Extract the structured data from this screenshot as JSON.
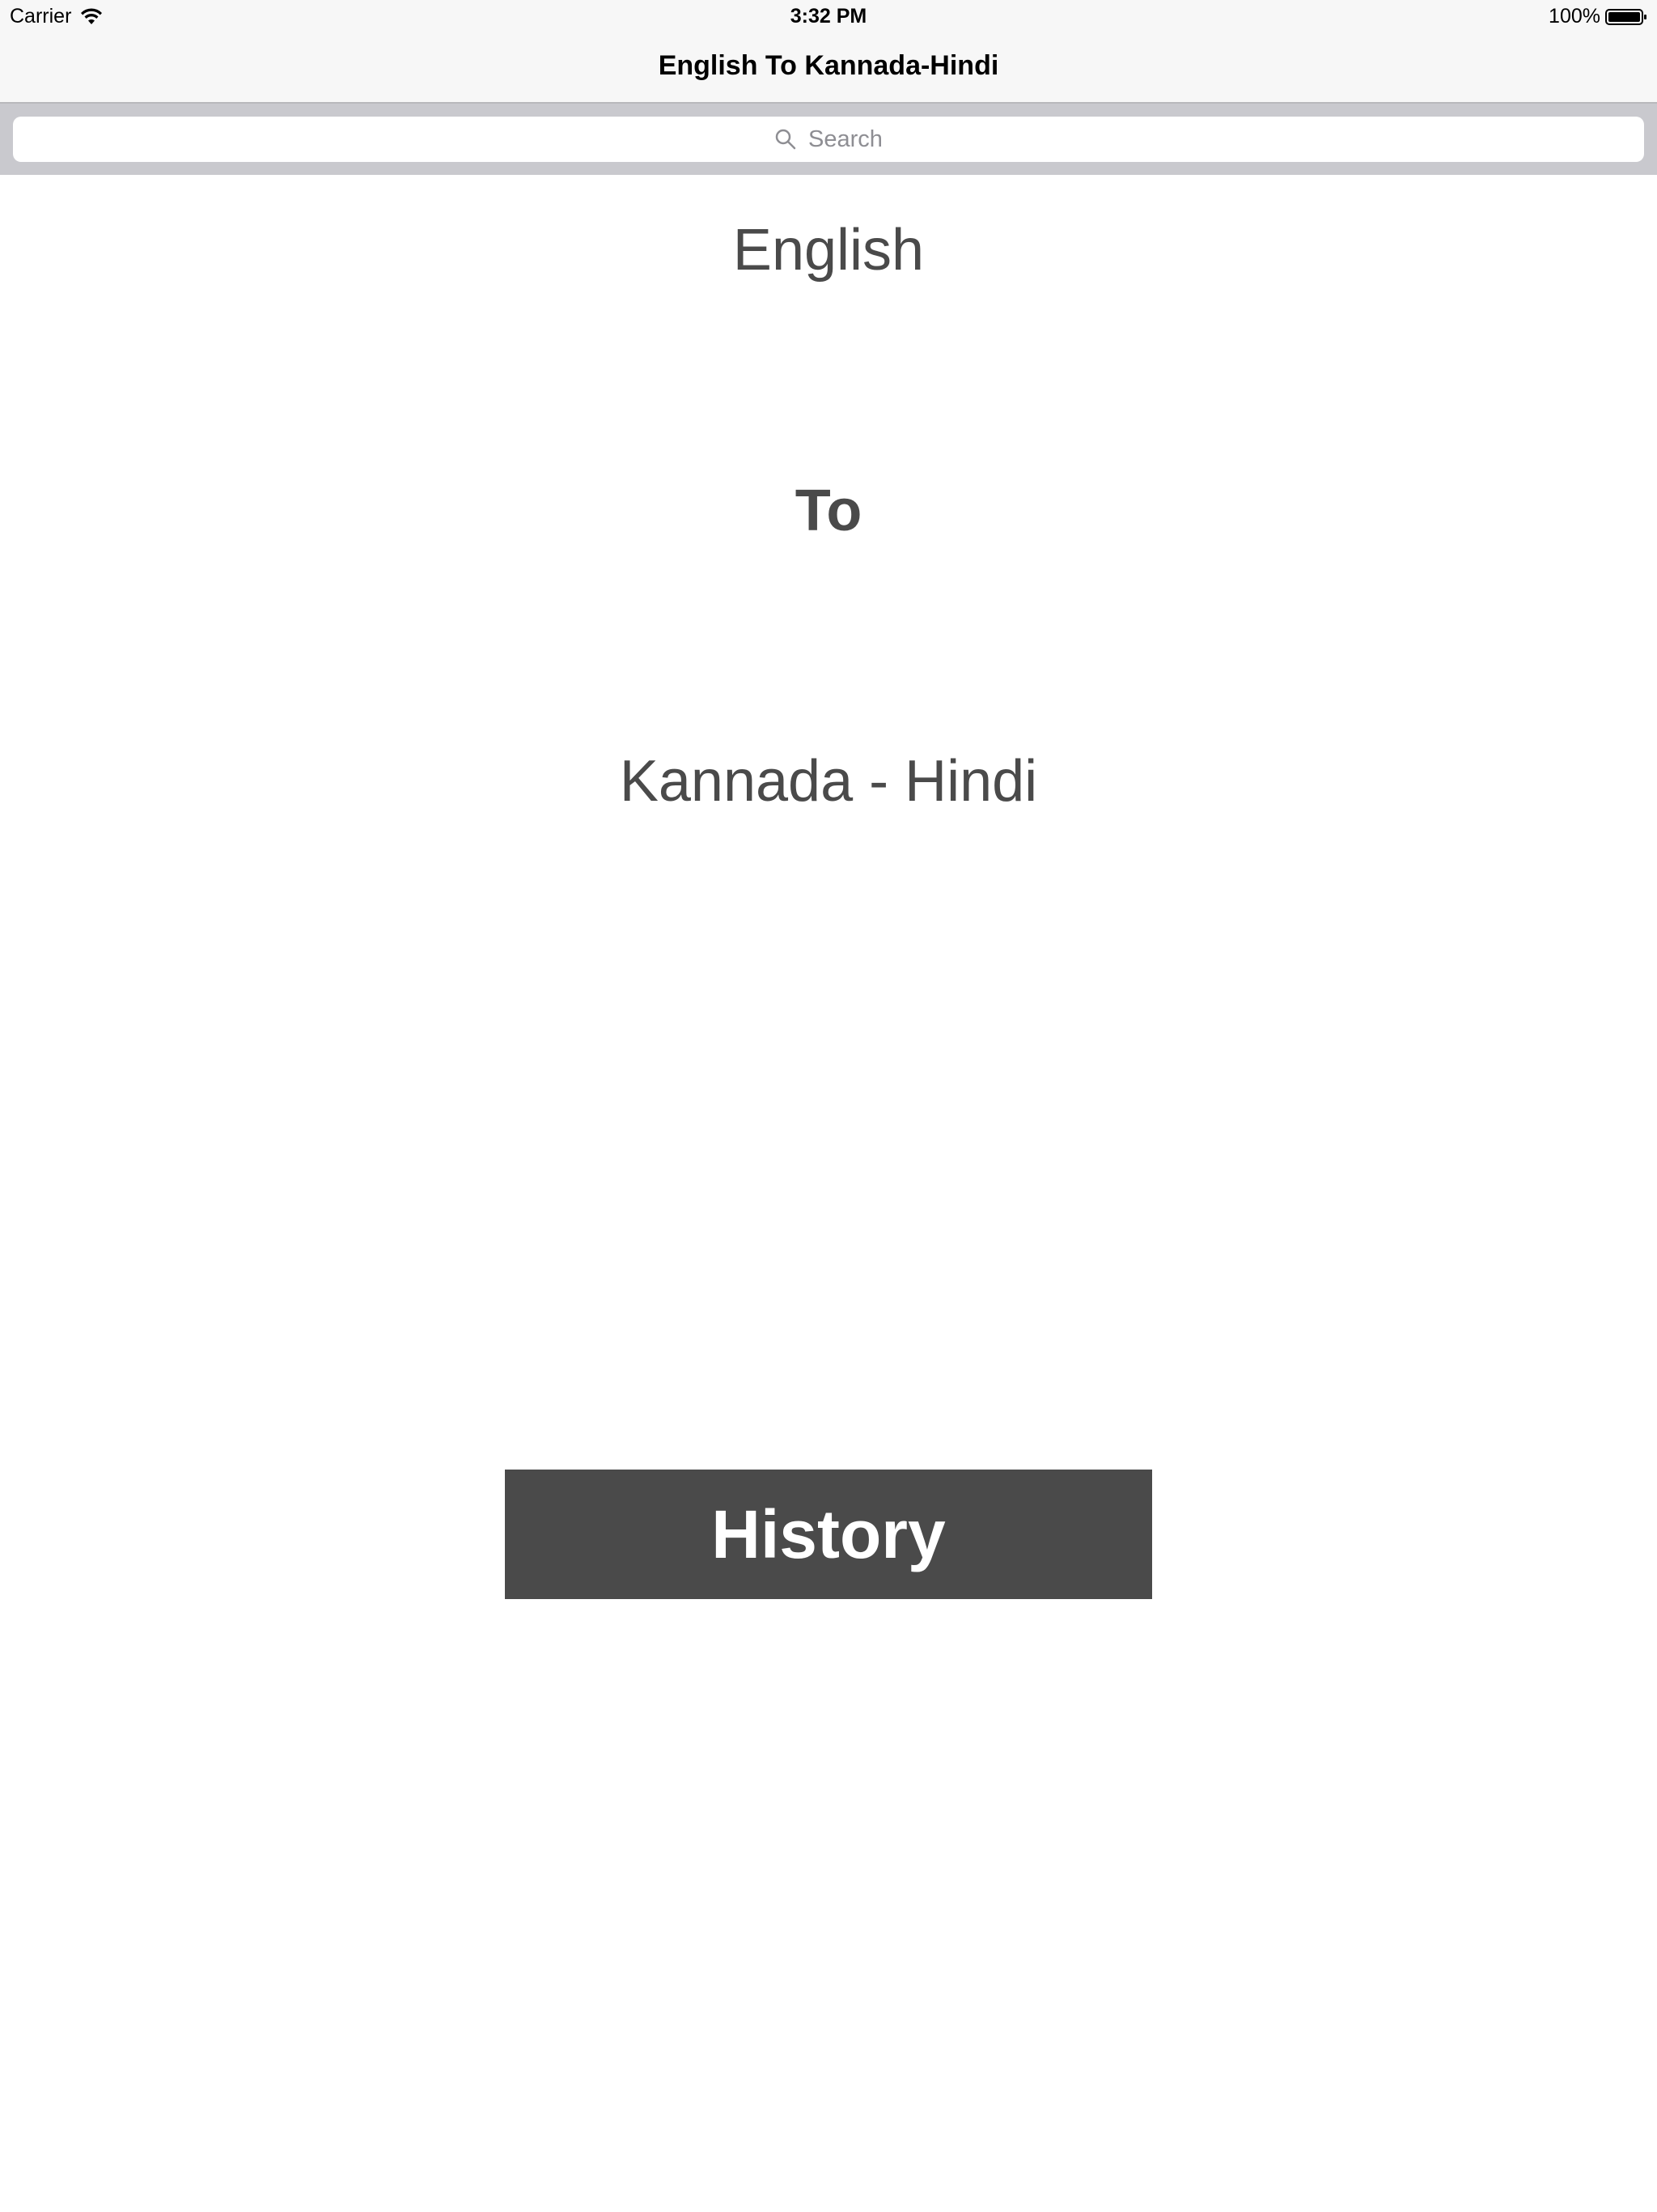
{
  "status_bar": {
    "carrier": "Carrier",
    "time": "3:32 PM",
    "battery": "100%"
  },
  "nav": {
    "title": "English To Kannada-Hindi"
  },
  "search": {
    "placeholder": "Search"
  },
  "main": {
    "line1": "English",
    "line2": "To",
    "line3": "Kannada - Hindi"
  },
  "history_button": {
    "label": "History"
  },
  "colors": {
    "headline_text": "#4a4a4a",
    "button_bg": "#4a4a4a",
    "search_bar_bg": "#c9c9ce"
  },
  "icons": [
    "wifi-icon",
    "search-icon",
    "battery-icon"
  ]
}
